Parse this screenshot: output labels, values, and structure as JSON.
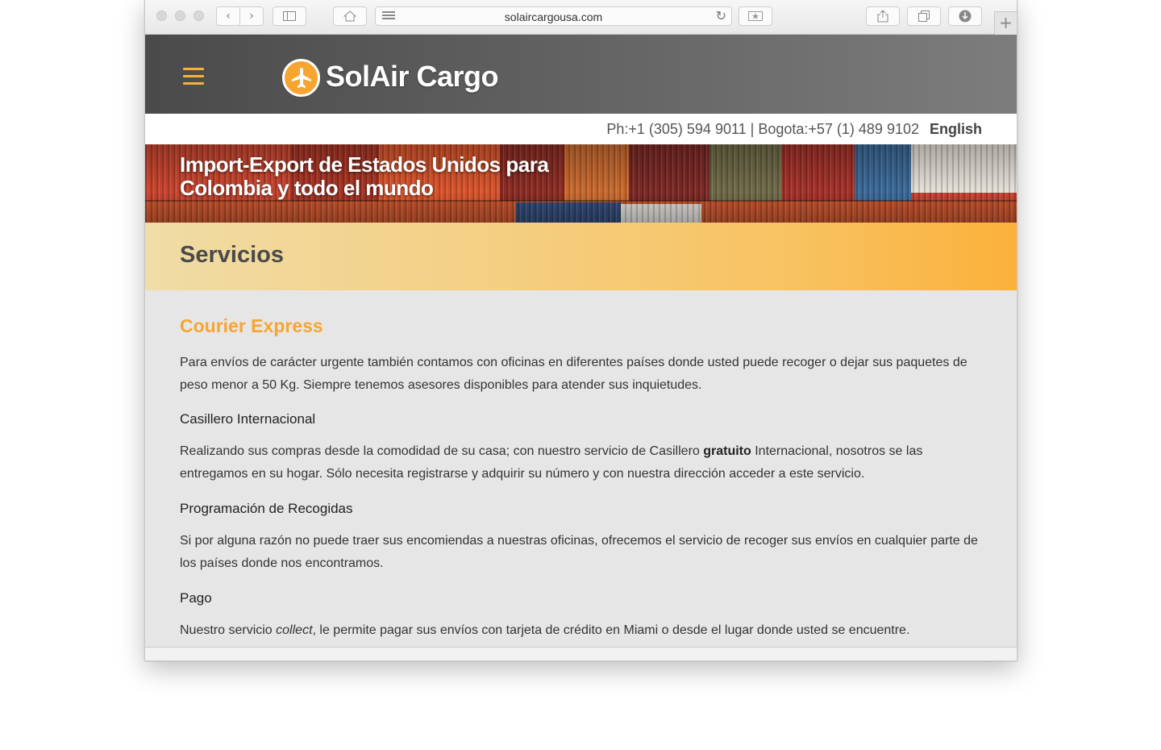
{
  "browser": {
    "url": "solaircargousa.com"
  },
  "site": {
    "logo_text": "SolAir Cargo",
    "phones": "Ph:+1 (305) 594 9011 | Bogota:+57 (1) 489 9102",
    "language_link": "English",
    "accent_color": "#f7a531",
    "header_color": "#555555"
  },
  "hero": {
    "title_line1": "Import-Export de Estados Unidos para",
    "title_line2": "Colombia y todo el mundo"
  },
  "section": {
    "title": "Servicios"
  },
  "services": {
    "courier_title": "Courier Express",
    "courier_text": "Para envíos de carácter urgente también contamos con oficinas en diferentes países donde usted puede recoger o dejar sus paquetes de peso menor a 50 Kg. Siempre tenemos asesores disponibles para atender sus inquietudes.",
    "casillero_title": "Casillero Internacional",
    "casillero_text_before": "Realizando sus compras desde la comodidad de su casa; con nuestro servicio de Casillero ",
    "casillero_text_bold": "gratuito",
    "casillero_text_after": " Internacional, nosotros se las entregamos en su hogar. Sólo necesita registrarse y adquirir su número y con nuestra dirección acceder a este servicio.",
    "recogidas_title": "Programación de Recogidas",
    "recogidas_text": "Si por alguna razón no puede traer sus encomiendas a nuestras oficinas, ofrecemos el servicio de recoger sus envíos en cualquier parte de los países donde nos encontramos.",
    "pago_title": "Pago",
    "pago_text_before": "Nuestro servicio ",
    "pago_text_italic": "collect",
    "pago_text_after": ", le permite pagar sus envíos con tarjeta de crédito en Miami o desde el lugar donde usted se encuentre."
  }
}
